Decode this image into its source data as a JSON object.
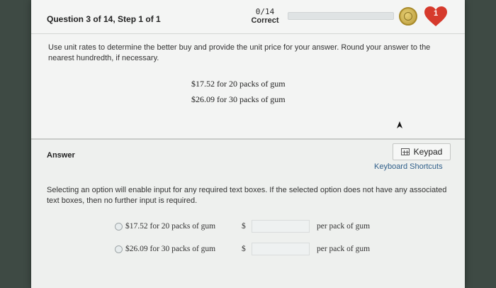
{
  "header": {
    "question_label": "Question 3 of 14, Step 1 of 1",
    "score_value": "0/14",
    "score_label": "Correct",
    "progress_fraction": 0,
    "lives": "1"
  },
  "question": {
    "prompt": "Use unit rates to determine the better buy and provide the unit price for your answer. Round your answer to the nearest hundredth, if necessary.",
    "offers": [
      "$17.52 for 20 packs of gum",
      "$26.09 for 30 packs of gum"
    ]
  },
  "answer": {
    "label": "Answer",
    "keypad_label": "Keypad",
    "keyboard_shortcuts_label": "Keyboard Shortcuts",
    "instruction": "Selecting an option will enable input for any required text boxes. If the selected option does not have any associated text boxes, then no further input is required.",
    "options": [
      {
        "text": "$17.52 for 20 packs of gum",
        "currency": "$",
        "unit": "per pack of gum",
        "value": ""
      },
      {
        "text": "$26.09 for 30 packs of gum",
        "currency": "$",
        "unit": "per pack of gum",
        "value": ""
      }
    ]
  },
  "colors": {
    "heart": "#d63a2c",
    "link": "#2f5f8a",
    "coin": "#c9ad4e"
  },
  "icons": {
    "coin": "coin-icon",
    "heart": "heart-icon",
    "keypad": "keypad-icon",
    "cursor": "mouse-pointer-icon"
  }
}
